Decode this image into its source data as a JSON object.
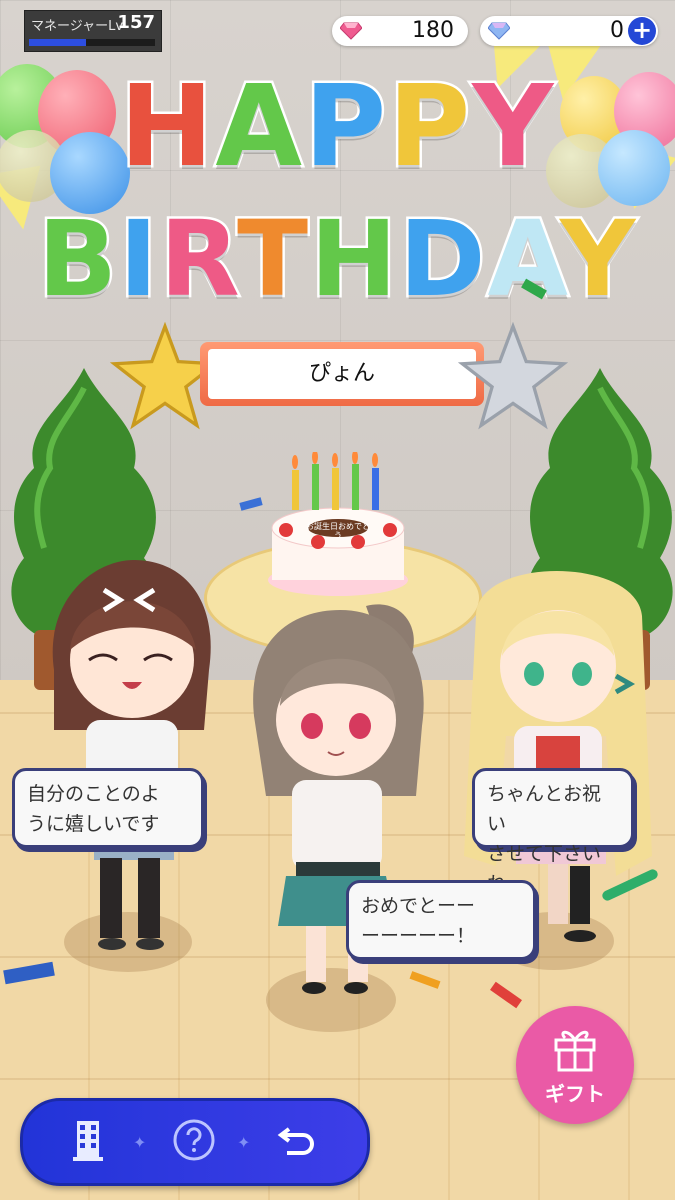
{
  "manager": {
    "label": "マネージャーLv",
    "level": "157",
    "exp_fraction": 0.45
  },
  "currency": [
    {
      "icon": "pink-gem-icon",
      "value": "180"
    },
    {
      "icon": "blue-gem-icon",
      "value": "0"
    }
  ],
  "title": {
    "line1": [
      "H",
      "A",
      "P",
      "P",
      "Y"
    ],
    "line2": [
      "B",
      "I",
      "R",
      "T",
      "H",
      "D",
      "A",
      "Y"
    ]
  },
  "title_colors": {
    "line1": [
      "#e8513e",
      "#63c84a",
      "#3fa2ee",
      "#f0c63a",
      "#ee5a86"
    ],
    "line2": [
      "#63c84a",
      "#3fa2ee",
      "#ee5a86",
      "#ef8a2e",
      "#63c84a",
      "#3fa2ee",
      "#bfe7f4",
      "#f0c63a"
    ]
  },
  "birthday_name": "ぴょん",
  "cake_text": "お誕生日おめでとう",
  "speech": [
    {
      "id": "left",
      "text_lines": [
        "自分のことのよ",
        "うに嬉しいです"
      ]
    },
    {
      "id": "right",
      "text_lines": [
        "ちゃんとお祝い",
        "させて下さいね"
      ]
    },
    {
      "id": "center",
      "text_lines": [
        "おめでとーー",
        "ーーーーー！"
      ]
    }
  ],
  "gift_button": {
    "label": "ギフト"
  },
  "nav": {
    "icons": [
      "building-icon",
      "help-icon",
      "back-icon"
    ]
  },
  "colors": {
    "accent": "#2448d6",
    "gift": "#ea5aa6",
    "bubble_border": "#3a3f7a"
  }
}
